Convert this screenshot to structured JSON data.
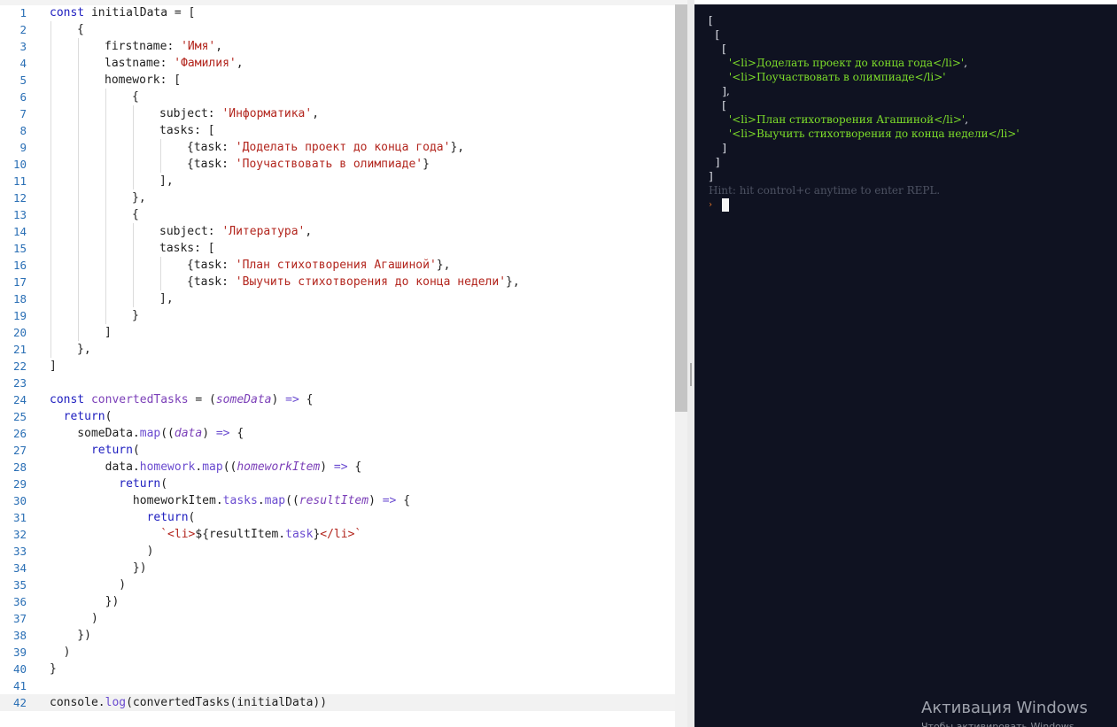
{
  "editor": {
    "active_line": 42,
    "lines": [
      {
        "n": "1",
        "indent": 0,
        "tokens": [
          [
            "k",
            "const "
          ],
          [
            "",
            "initialData = ["
          ]
        ]
      },
      {
        "n": "2",
        "indent": 1,
        "tokens": [
          [
            "",
            "{"
          ]
        ]
      },
      {
        "n": "3",
        "indent": 2,
        "tokens": [
          [
            "",
            "firstname: "
          ],
          [
            "s",
            "'Имя'"
          ],
          [
            "",
            ","
          ]
        ]
      },
      {
        "n": "4",
        "indent": 2,
        "tokens": [
          [
            "",
            "lastname: "
          ],
          [
            "s",
            "'Фамилия'"
          ],
          [
            "",
            ","
          ]
        ]
      },
      {
        "n": "5",
        "indent": 2,
        "tokens": [
          [
            "",
            "homework: ["
          ]
        ]
      },
      {
        "n": "6",
        "indent": 3,
        "tokens": [
          [
            "",
            "{"
          ]
        ]
      },
      {
        "n": "7",
        "indent": 4,
        "tokens": [
          [
            "",
            "subject: "
          ],
          [
            "s",
            "'Информатика'"
          ],
          [
            "",
            ","
          ]
        ]
      },
      {
        "n": "8",
        "indent": 4,
        "tokens": [
          [
            "",
            "tasks: ["
          ]
        ]
      },
      {
        "n": "9",
        "indent": 5,
        "tokens": [
          [
            "",
            "{task: "
          ],
          [
            "s",
            "'Доделать проект до конца года'"
          ],
          [
            "",
            "},"
          ]
        ]
      },
      {
        "n": "10",
        "indent": 5,
        "tokens": [
          [
            "",
            "{task: "
          ],
          [
            "s",
            "'Поучаствовать в олимпиаде'"
          ],
          [
            "",
            "}"
          ]
        ]
      },
      {
        "n": "11",
        "indent": 4,
        "tokens": [
          [
            "",
            "],"
          ]
        ]
      },
      {
        "n": "12",
        "indent": 3,
        "tokens": [
          [
            "",
            "},"
          ]
        ]
      },
      {
        "n": "13",
        "indent": 3,
        "tokens": [
          [
            "",
            "{"
          ]
        ]
      },
      {
        "n": "14",
        "indent": 4,
        "tokens": [
          [
            "",
            "subject: "
          ],
          [
            "s",
            "'Литература'"
          ],
          [
            "",
            ","
          ]
        ]
      },
      {
        "n": "15",
        "indent": 4,
        "tokens": [
          [
            "",
            "tasks: ["
          ]
        ]
      },
      {
        "n": "16",
        "indent": 5,
        "tokens": [
          [
            "",
            "{task: "
          ],
          [
            "s",
            "'План стихотворения Агашиной'"
          ],
          [
            "",
            "},"
          ]
        ]
      },
      {
        "n": "17",
        "indent": 5,
        "tokens": [
          [
            "",
            "{task: "
          ],
          [
            "s",
            "'Выучить стихотворения до конца недели'"
          ],
          [
            "",
            "},"
          ]
        ]
      },
      {
        "n": "18",
        "indent": 4,
        "tokens": [
          [
            "",
            "],"
          ]
        ]
      },
      {
        "n": "19",
        "indent": 3,
        "tokens": [
          [
            "",
            "}"
          ]
        ]
      },
      {
        "n": "20",
        "indent": 2,
        "tokens": [
          [
            "",
            "]"
          ]
        ]
      },
      {
        "n": "21",
        "indent": 1,
        "tokens": [
          [
            "",
            "},"
          ]
        ]
      },
      {
        "n": "22",
        "indent": 0,
        "tokens": [
          [
            "",
            "]"
          ]
        ]
      },
      {
        "n": "23",
        "indent": 0,
        "tokens": []
      },
      {
        "n": "24",
        "indent": 0,
        "tokens": [
          [
            "k",
            "const "
          ],
          [
            "v",
            "convertedTasks"
          ],
          [
            "",
            " = ("
          ],
          [
            "p",
            "someData"
          ],
          [
            "",
            ") "
          ],
          [
            "ar",
            "=>"
          ],
          [
            "",
            " {"
          ]
        ]
      },
      {
        "n": "25",
        "indent": 0,
        "tokens": [
          [
            "",
            "  "
          ],
          [
            "k",
            "return"
          ],
          [
            "",
            "("
          ]
        ]
      },
      {
        "n": "26",
        "indent": 0,
        "tokens": [
          [
            "",
            "    someData."
          ],
          [
            "m",
            "map"
          ],
          [
            "",
            "(("
          ],
          [
            "p",
            "data"
          ],
          [
            "",
            ") "
          ],
          [
            "ar",
            "=>"
          ],
          [
            "",
            " {"
          ]
        ]
      },
      {
        "n": "27",
        "indent": 0,
        "tokens": [
          [
            "",
            "      "
          ],
          [
            "k",
            "return"
          ],
          [
            "",
            "("
          ]
        ]
      },
      {
        "n": "28",
        "indent": 0,
        "tokens": [
          [
            "",
            "        data."
          ],
          [
            "m",
            "homework"
          ],
          [
            "",
            "."
          ],
          [
            "m",
            "map"
          ],
          [
            "",
            "(("
          ],
          [
            "p",
            "homeworkItem"
          ],
          [
            "",
            ") "
          ],
          [
            "ar",
            "=>"
          ],
          [
            "",
            " {"
          ]
        ]
      },
      {
        "n": "29",
        "indent": 0,
        "tokens": [
          [
            "",
            "          "
          ],
          [
            "k",
            "return"
          ],
          [
            "",
            "("
          ]
        ]
      },
      {
        "n": "30",
        "indent": 0,
        "tokens": [
          [
            "",
            "            homeworkItem."
          ],
          [
            "m",
            "tasks"
          ],
          [
            "",
            "."
          ],
          [
            "m",
            "map"
          ],
          [
            "",
            "(("
          ],
          [
            "p",
            "resultItem"
          ],
          [
            "",
            ") "
          ],
          [
            "ar",
            "=>"
          ],
          [
            "",
            " {"
          ]
        ]
      },
      {
        "n": "31",
        "indent": 0,
        "tokens": [
          [
            "",
            "              "
          ],
          [
            "k",
            "return"
          ],
          [
            "",
            "("
          ]
        ]
      },
      {
        "n": "32",
        "indent": 0,
        "tokens": [
          [
            "",
            "                "
          ],
          [
            "s",
            "`<li>"
          ],
          [
            "",
            "${resultItem."
          ],
          [
            "m",
            "task"
          ],
          [
            "",
            "}"
          ],
          [
            "s",
            "</li>`"
          ]
        ]
      },
      {
        "n": "33",
        "indent": 0,
        "tokens": [
          [
            "",
            "              )"
          ]
        ]
      },
      {
        "n": "34",
        "indent": 0,
        "tokens": [
          [
            "",
            "            })"
          ]
        ]
      },
      {
        "n": "35",
        "indent": 0,
        "tokens": [
          [
            "",
            "          )"
          ]
        ]
      },
      {
        "n": "36",
        "indent": 0,
        "tokens": [
          [
            "",
            "        })"
          ]
        ]
      },
      {
        "n": "37",
        "indent": 0,
        "tokens": [
          [
            "",
            "      )"
          ]
        ]
      },
      {
        "n": "38",
        "indent": 0,
        "tokens": [
          [
            "",
            "    })"
          ]
        ]
      },
      {
        "n": "39",
        "indent": 0,
        "tokens": [
          [
            "",
            "  )"
          ]
        ]
      },
      {
        "n": "40",
        "indent": 0,
        "tokens": [
          [
            "",
            "}"
          ]
        ]
      },
      {
        "n": "41",
        "indent": 0,
        "tokens": []
      },
      {
        "n": "42",
        "indent": 0,
        "tokens": [
          [
            "",
            "console."
          ],
          [
            "m",
            "log"
          ],
          [
            "",
            "(convertedTasks(initialData))"
          ]
        ]
      }
    ]
  },
  "console": {
    "output": [
      [
        [
          "",
          "["
        ]
      ],
      [
        [
          "",
          "  ["
        ]
      ],
      [
        [
          "",
          "    ["
        ]
      ],
      [
        [
          "",
          "      "
        ],
        [
          "cs",
          "'<li>Доделать проект до конца года</li>'"
        ],
        [
          "",
          ","
        ]
      ],
      [
        [
          "",
          "      "
        ],
        [
          "cs",
          "'<li>Поучаствовать в олимпиаде</li>'"
        ]
      ],
      [
        [
          "",
          "    ],"
        ]
      ],
      [
        [
          "",
          "    ["
        ]
      ],
      [
        [
          "",
          "      "
        ],
        [
          "cs",
          "'<li>План стихотворения Агашиной</li>'"
        ],
        [
          "",
          ","
        ]
      ],
      [
        [
          "",
          "      "
        ],
        [
          "cs",
          "'<li>Выучить стихотворения до конца недели</li>'"
        ]
      ],
      [
        [
          "",
          "    ]"
        ]
      ],
      [
        [
          "",
          "  ]"
        ]
      ],
      [
        [
          "",
          "]"
        ]
      ],
      [
        [
          "hint",
          "Hint: hit control+c anytime to enter REPL."
        ]
      ]
    ],
    "prompt_glyph": "›"
  },
  "watermark": {
    "title": "Активация Windows",
    "subtitle": "Чтобы активировать Windows"
  },
  "colors": {
    "console_bg": "#0f1221",
    "console_string": "#7ddd2a",
    "keyword": "#2020c0",
    "string": "#b3261e",
    "line_number": "#2a6fb5"
  }
}
